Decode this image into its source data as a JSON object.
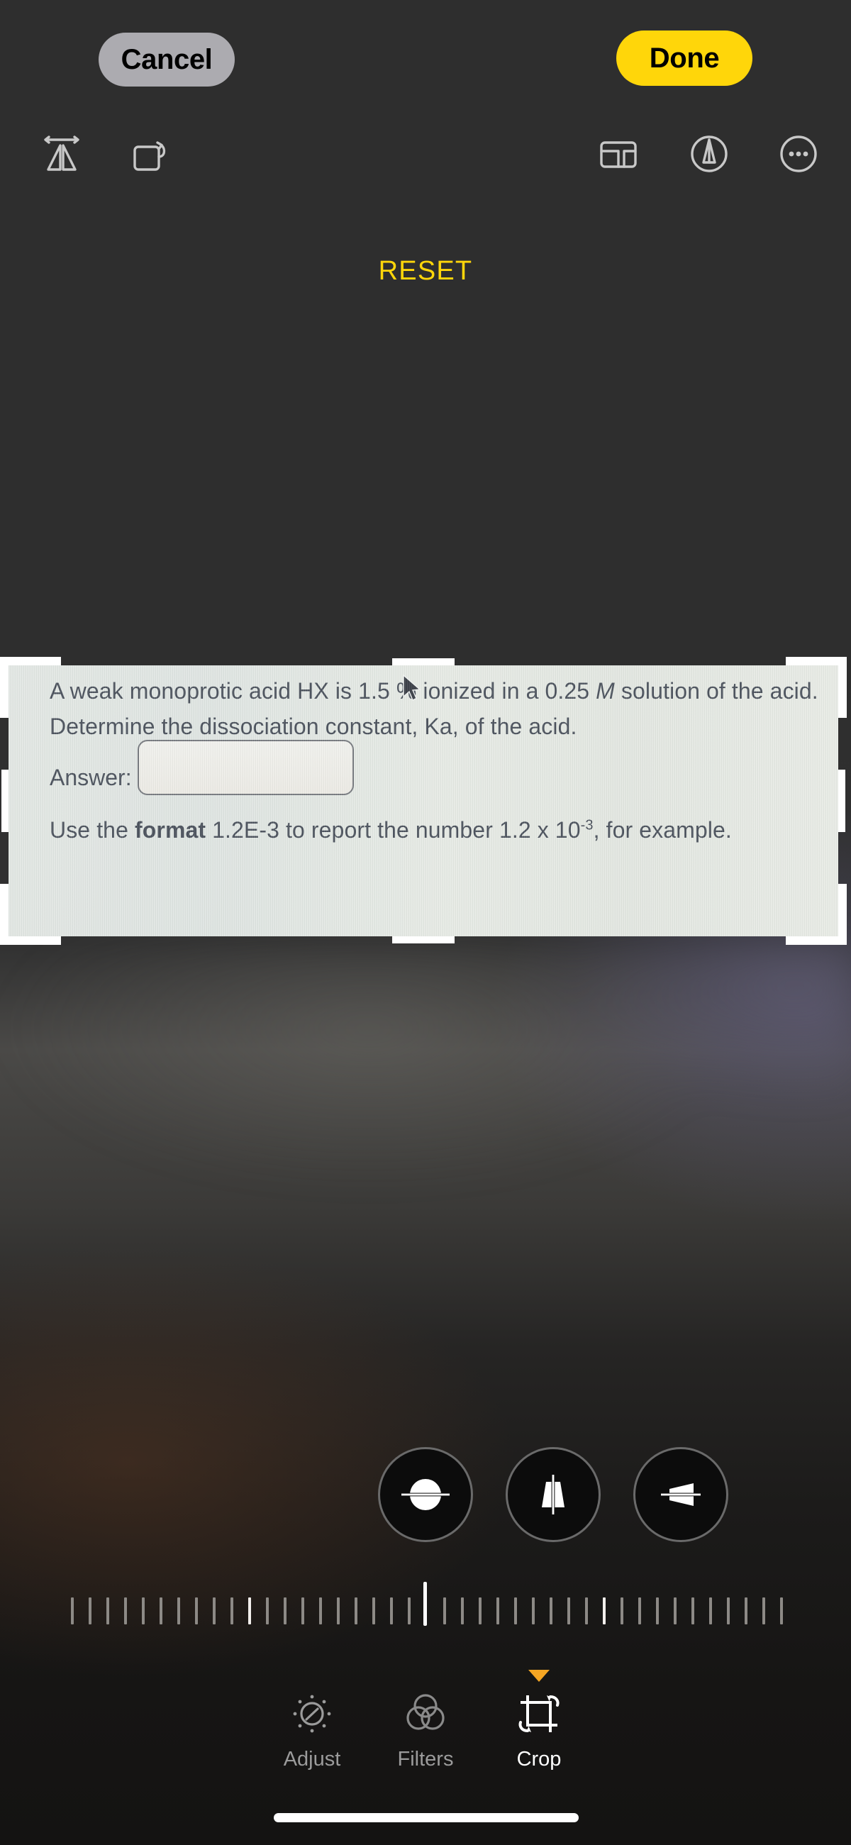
{
  "app": {
    "name": "Photos Editor",
    "mode": "Crop"
  },
  "topbar": {
    "cancel_label": "Cancel",
    "done_label": "Done",
    "cancel_color": "#ACABB0",
    "done_color": "#FFD60A"
  },
  "toolrow": {
    "reset_label": "RESET",
    "reset_color": "#FFD60A",
    "left_tools": [
      {
        "name": "flip-horizontal-icon",
        "label": "Flip"
      },
      {
        "name": "rotate-icon",
        "label": "Rotate"
      }
    ],
    "right_tools": [
      {
        "name": "aspect-ratio-icon",
        "label": "Aspect Ratio"
      },
      {
        "name": "markup-icon",
        "label": "Markup"
      },
      {
        "name": "more-options-icon",
        "label": "More"
      }
    ]
  },
  "photo": {
    "alt": "Photograph of a chemistry homework question on a computer screen",
    "paper_color": "#E2E7E1",
    "text_color": "#3D4450",
    "question_line1_a": "A weak monoprotic acid HX is 1.5 % ionized in a 0.25 ",
    "question_line1_em": "M",
    "question_line1_b": " solution of the acid.",
    "question_line2": "Determine the dissociation constant, Ka, of the acid.",
    "answer_label": "Answer:",
    "answer_value": "",
    "answer_placeholder": "",
    "format_line_a": "Use the ",
    "format_line_bold": "format",
    "format_line_b": " 1.2E-3 to report the number 1.2 x 10",
    "format_exponent": "-3",
    "format_line_c": ", for example."
  },
  "crop": {
    "handle_color": "#FFFFFF",
    "handles": [
      "corner-top-left",
      "corner-top-right",
      "corner-bottom-left",
      "corner-bottom-right",
      "edge-top",
      "edge-bottom",
      "edge-left",
      "edge-right"
    ]
  },
  "perspective_controls": [
    {
      "name": "straighten-button",
      "label": "Straighten",
      "selected": false
    },
    {
      "name": "vertical-perspective-button",
      "label": "Vertical",
      "selected": false
    },
    {
      "name": "horizontal-perspective-button",
      "label": "Horizontal",
      "selected": false
    }
  ],
  "ruler": {
    "value": "0",
    "tick_count": 41,
    "indicator_color": "#FFFFFF"
  },
  "tabs": [
    {
      "name": "tab-adjust",
      "label": "Adjust",
      "icon": "adjust-dial-icon",
      "active": false
    },
    {
      "name": "tab-filters",
      "label": "Filters",
      "icon": "filters-circles-icon",
      "active": false
    },
    {
      "name": "tab-crop",
      "label": "Crop",
      "icon": "crop-rotate-icon",
      "active": true
    }
  ],
  "tab_indicator_color": "#F5A623"
}
